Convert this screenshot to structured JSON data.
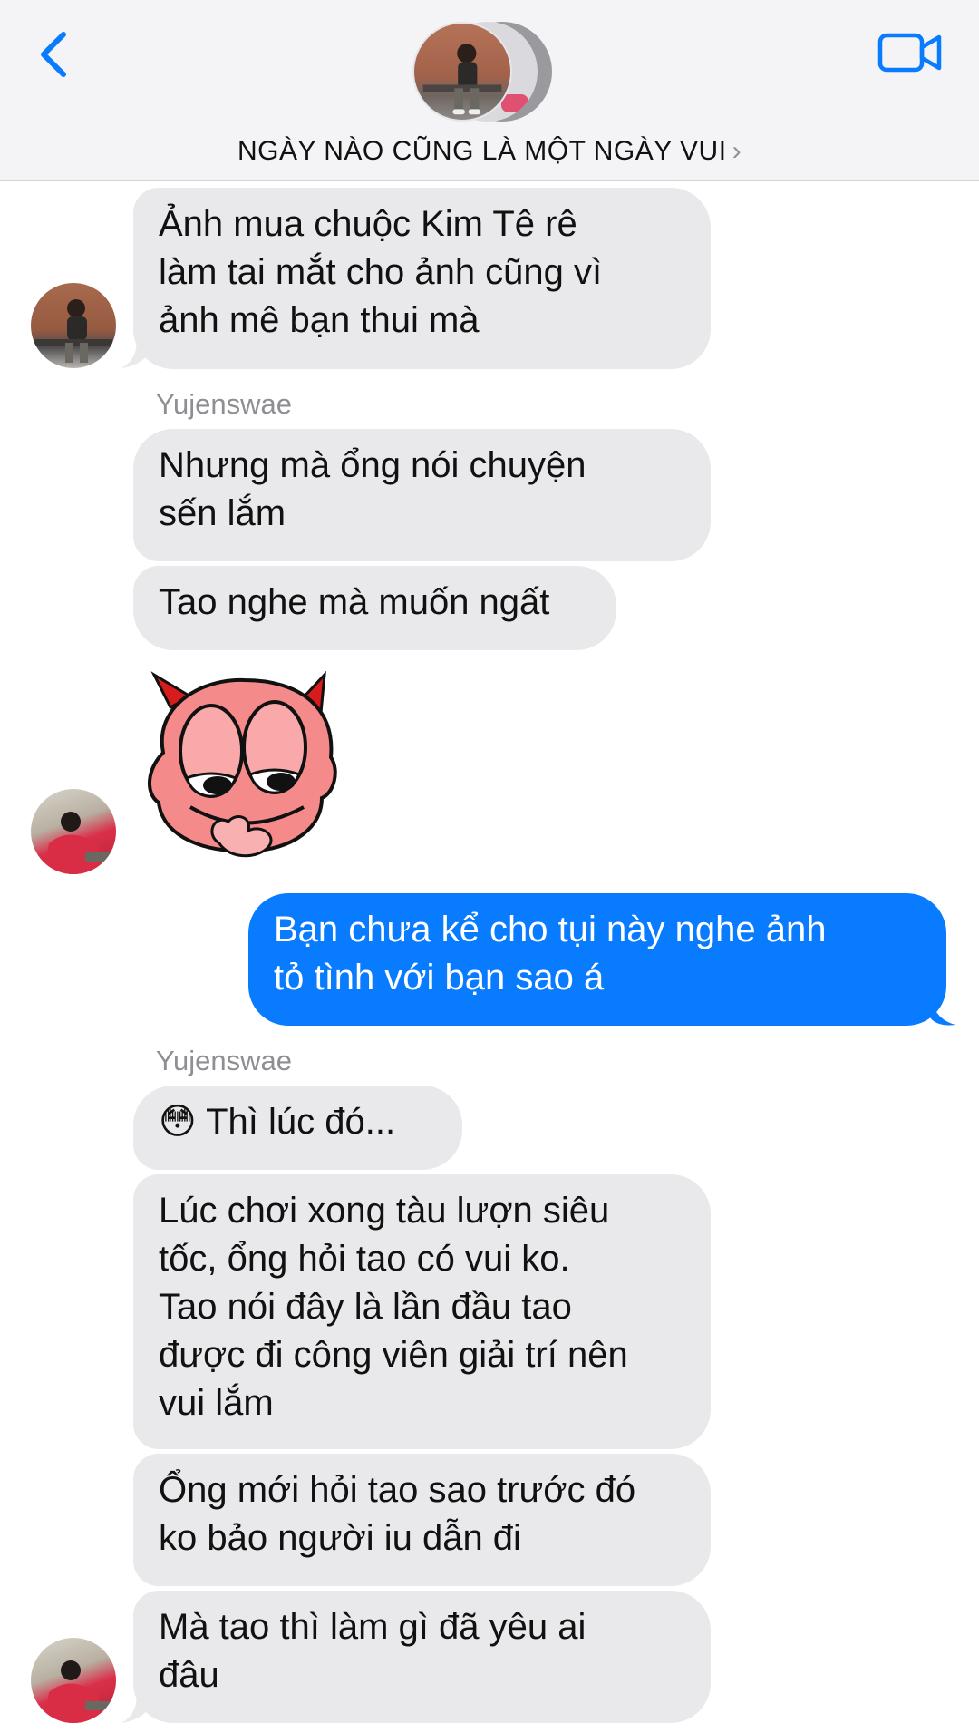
{
  "header": {
    "title": "NGÀY NÀO CŨNG LÀ MỘT NGÀY VUI",
    "chevron": "›",
    "back_icon": "chevron-left-icon",
    "video_icon": "video-camera-icon",
    "accent": "#087bff"
  },
  "messages": [
    {
      "id": "m1",
      "side": "incoming",
      "lines": [
        "Ảnh mua chuộc Kim Tê rê",
        "làm tai mắt cho ảnh cũng vì",
        "ảnh mê bạn thui mà"
      ]
    },
    {
      "id": "m2",
      "side": "incoming",
      "sender": "Yujenswae",
      "lines": [
        "Nhưng mà ổng nói chuyện",
        "sến lắm"
      ]
    },
    {
      "id": "m3",
      "side": "incoming",
      "lines": [
        "Tao nghe mà muốn ngất"
      ]
    },
    {
      "id": "m4",
      "side": "incoming",
      "type": "sticker",
      "sticker": "pink-devil-blushing-sticker"
    },
    {
      "id": "m5",
      "side": "outgoing",
      "lines": [
        "Bạn chưa kể cho tụi này nghe ảnh",
        "tỏ tình với bạn sao á"
      ]
    },
    {
      "id": "m6",
      "side": "incoming",
      "sender": "Yujenswae",
      "emoji": "😳",
      "lines": [
        "Thì lúc đó..."
      ]
    },
    {
      "id": "m7",
      "side": "incoming",
      "lines": [
        "Lúc chơi xong tàu lượn siêu",
        "tốc, ổng hỏi tao có vui ko.",
        "Tao nói đây là lần đầu tao",
        "được đi công viên giải trí nên",
        "vui lắm"
      ]
    },
    {
      "id": "m8",
      "side": "incoming",
      "lines": [
        "Ổng mới hỏi tao sao trước đó",
        "ko bảo người iu dẫn đi"
      ]
    },
    {
      "id": "m9",
      "side": "incoming",
      "lines": [
        "Mà tao thì làm gì đã yêu ai",
        "đâu"
      ]
    }
  ],
  "colors": {
    "incoming_bubble": "#e9e9eb",
    "outgoing_bubble": "#087bff",
    "header_bg": "#f4f4f6"
  }
}
